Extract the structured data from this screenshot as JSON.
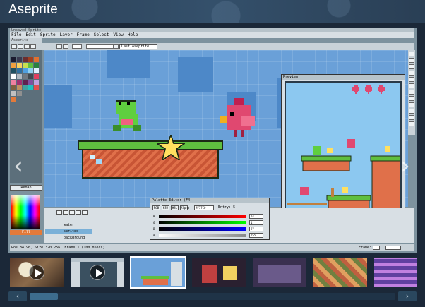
{
  "page": {
    "game_title": "Aseprite"
  },
  "screenshot": {
    "window_title": "Unsaved Sprite",
    "menu": [
      "File",
      "Edit",
      "Sprite",
      "Layer",
      "Frame",
      "Select",
      "View",
      "Help"
    ],
    "doc_tab": "Aseprite",
    "layer_select": "Last Aseprite",
    "remap_label": "Remap",
    "fg_swatch_label": "Fill",
    "palette_editor": {
      "title": "Palette Editor (F4)",
      "modes": [
        "RGB",
        "HSV",
        "HSL",
        "Alpha"
      ],
      "hex_value": "#F77C0",
      "entry": "Entry: 5",
      "rows": [
        {
          "label": "R",
          "value": "24"
        },
        {
          "label": "G",
          "value": "1"
        },
        {
          "label": "B",
          "value": "97"
        },
        {
          "label": "A",
          "value": "255"
        }
      ]
    },
    "preview_title": "Preview",
    "layers": [
      "",
      "water",
      "sprites",
      "background"
    ],
    "status_text": "Pos 84 96, Size 320 256, Frame 1 (100 msecs)",
    "frame_label": "Frame:"
  },
  "gallery": {
    "prev_label": "‹",
    "next_label": "›",
    "strip_prev": "‹",
    "strip_next": "›"
  },
  "colors": {
    "page_bg": "#1b2838",
    "sky": "#6aa0d8",
    "grass": "#5fbf3f",
    "brick": "#e0704a",
    "thumb_active_border": "#ffffff"
  },
  "thumbnails": [
    {
      "kind": "video",
      "icon": "play-icon"
    },
    {
      "kind": "video",
      "icon": "play-icon"
    },
    {
      "kind": "image",
      "active": true
    },
    {
      "kind": "image"
    },
    {
      "kind": "image"
    },
    {
      "kind": "image"
    },
    {
      "kind": "image"
    }
  ]
}
